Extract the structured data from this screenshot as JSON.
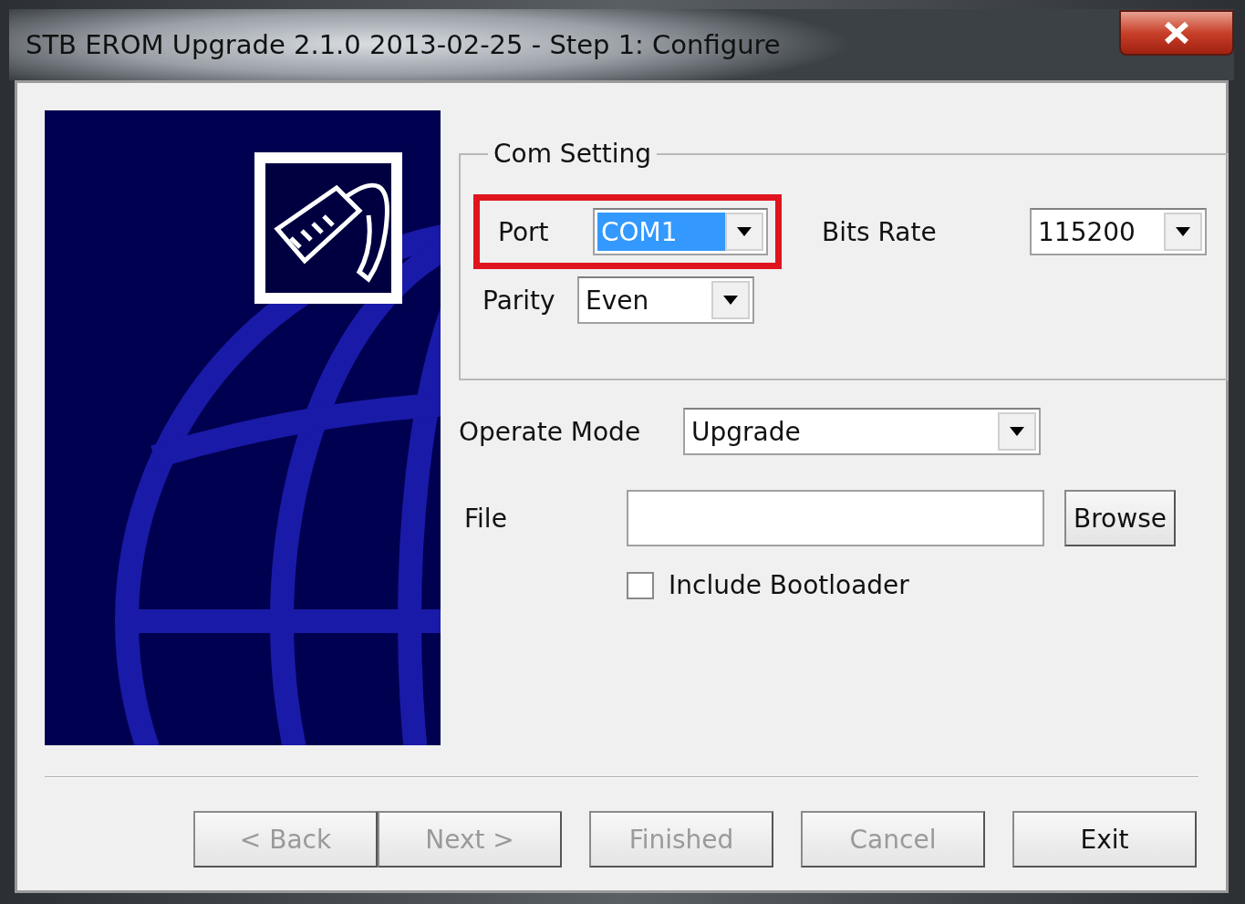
{
  "window": {
    "title": "STB EROM Upgrade 2.1.0 2013-02-25 - Step 1: Configure"
  },
  "com_setting": {
    "title": "Com Setting",
    "port": {
      "label": "Port",
      "value": "COM1",
      "text_selected": true,
      "highlighted": true
    },
    "bits_rate": {
      "label": "Bits Rate",
      "value": "115200"
    },
    "parity": {
      "label": "Parity",
      "value": "Even"
    }
  },
  "operate_mode": {
    "label": "Operate Mode",
    "value": "Upgrade"
  },
  "file": {
    "label": "File",
    "browse": "Browse"
  },
  "include_bootloader": {
    "label": "Include Bootloader",
    "checked": false
  },
  "buttons": [
    {
      "label": "< Back",
      "disabled": true
    },
    {
      "label": "Next >",
      "disabled": true
    },
    {
      "label": "Finished",
      "disabled": true
    },
    {
      "label": "Cancel",
      "disabled": true
    },
    {
      "label": "Exit",
      "disabled": false
    }
  ]
}
